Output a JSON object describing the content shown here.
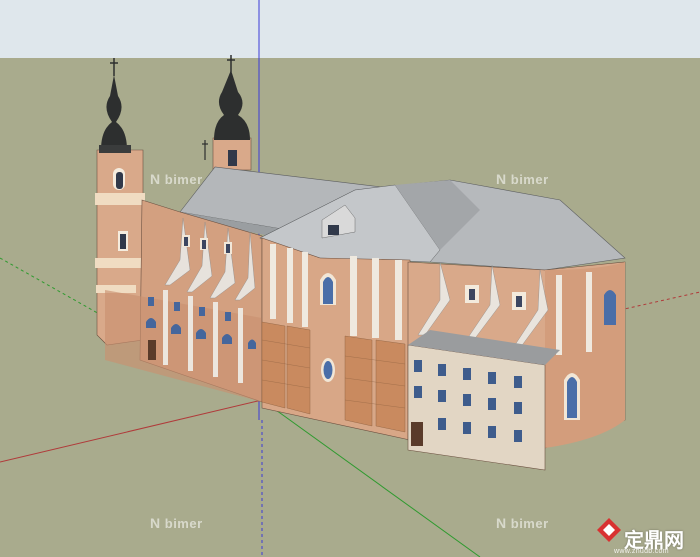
{
  "watermarks": [
    {
      "text": "bimer"
    },
    {
      "text": "bimer"
    },
    {
      "text": "bimer"
    },
    {
      "text": "bimer"
    }
  ],
  "logo": {
    "text": "定鼎网",
    "url": "www.zhudb.com"
  },
  "colors": {
    "sky": "#dfe7ec",
    "ground": "#a9ab8d",
    "roof": "#b4b7ba",
    "wall": "#d7a487",
    "wall_shadow": "#c4906f",
    "dome": "#2d2f2f",
    "window": "#3f5f8f",
    "axis_blue": "#3b3bd9",
    "axis_red": "#c24040",
    "axis_green": "#3aa53a"
  },
  "icons": [
    "cross-icon",
    "logo-diamond-icon"
  ]
}
